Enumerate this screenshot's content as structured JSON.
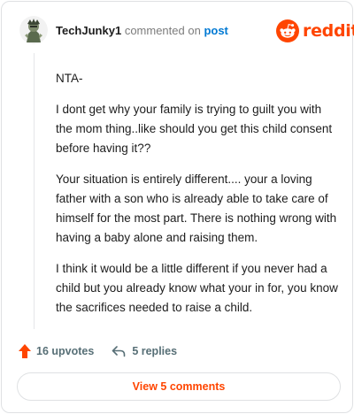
{
  "header": {
    "username": "TechJunky1",
    "commented_on": "commented on",
    "post_link": "post",
    "brand": "reddit",
    "brand_color": "#ff4500",
    "avatar_icon": "avatar-icon"
  },
  "comment": {
    "paragraphs": [
      "NTA-",
      "I dont get why your family is trying to guilt you with the mom thing..like should you get this child consent before having it??",
      "Your situation is entirely different.... your a loving father with a son who is already able to take care of himself for the most part. There is nothing wrong with having a baby alone and raising them.",
      "I think it would be a little different if you never had a child but you already know what your in for, you know the sacrifices needed to raise a child."
    ]
  },
  "actions": {
    "upvotes": "16 upvotes",
    "replies": "5 replies",
    "upvote_icon": "upvote-arrow-icon",
    "reply_icon": "reply-arrow-icon"
  },
  "footer": {
    "view_comments": "View 5 comments"
  }
}
